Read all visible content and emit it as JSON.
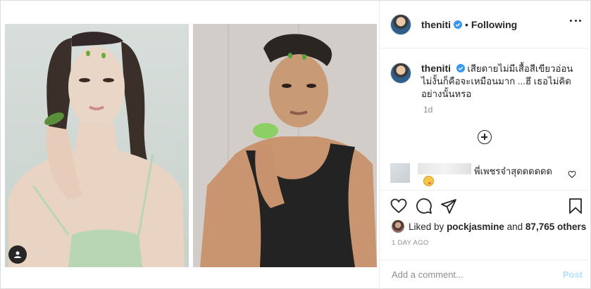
{
  "post": {
    "username": "theniti",
    "follow_status": "Following",
    "separator": "•",
    "caption_user": "theniti",
    "caption_text": "เสียดายไม่มีเสื้อสีเขียวอ่อน ไม่งั้นก็คือจะเหมือนมาก ...ฮึ เธอไม่คิดอย่างนั้นหรอ",
    "caption_time": "1d",
    "comment": {
      "text": "พี่เพชรจ๋าสุดดดดดด",
      "emoji": "face-emoji"
    },
    "likes": {
      "prefix": "Liked by",
      "liker": "pockjasmine",
      "joiner": "and",
      "count_text": "87,765 others"
    },
    "time_ago": "1 DAY AGO",
    "add_comment_placeholder": "Add a comment...",
    "post_button": "Post"
  },
  "colors": {
    "verified": "#3897f0",
    "post_button": "#b2dffc",
    "muted": "#8e8e8e"
  },
  "icons": [
    "verified-icon",
    "more-options-icon",
    "load-more-comments-icon",
    "comment-like-icon",
    "like-icon",
    "comment-icon",
    "share-icon",
    "save-icon",
    "user-tag-icon"
  ]
}
